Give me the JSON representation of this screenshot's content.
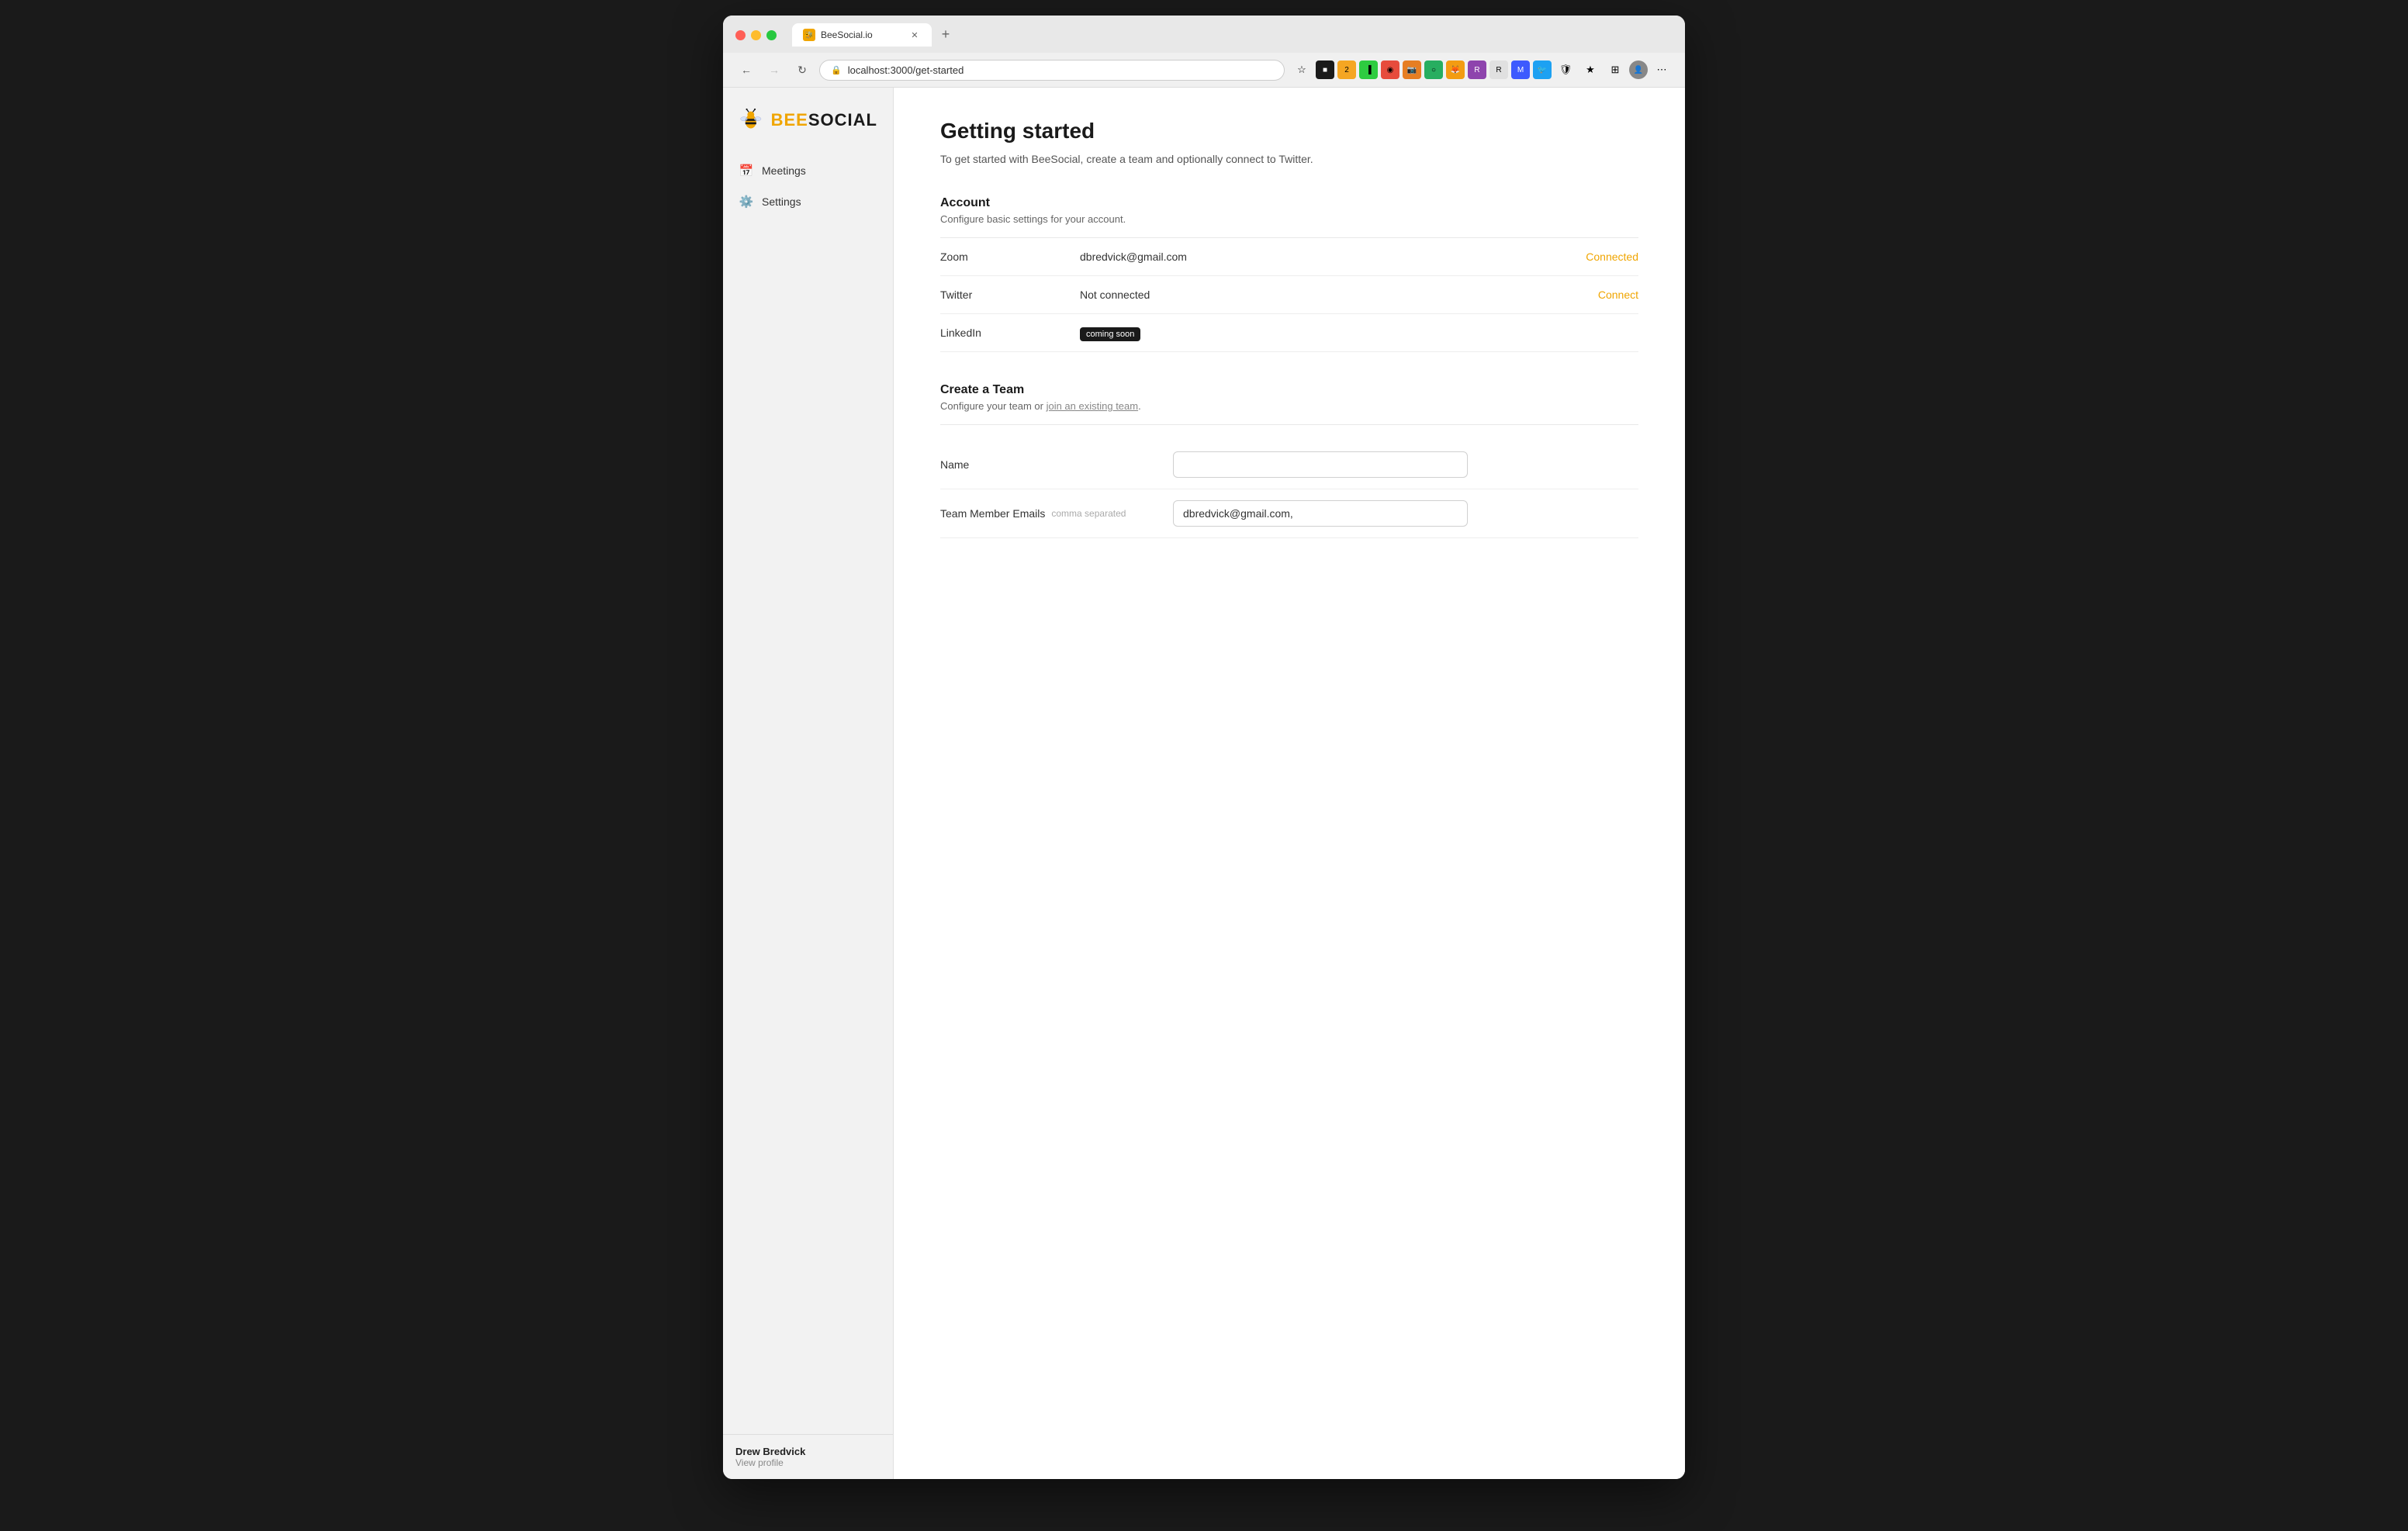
{
  "browser": {
    "url": "localhost:3000/get-started",
    "tab_title": "BeeSocial.io",
    "tab_favicon": "🐝",
    "back_disabled": false,
    "forward_disabled": true
  },
  "sidebar": {
    "logo_bee": "🐝",
    "logo_text_prefix": "BEE",
    "logo_text_suffix": "SOCIAL",
    "items": [
      {
        "id": "meetings",
        "label": "Meetings",
        "icon": "📅"
      },
      {
        "id": "settings",
        "label": "Settings",
        "icon": "⚙️"
      }
    ],
    "user": {
      "name": "Drew Bredvick",
      "view_profile_label": "View profile"
    }
  },
  "page": {
    "title": "Getting started",
    "subtitle": "To get started with BeeSocial, create a team and optionally connect to Twitter."
  },
  "account_section": {
    "title": "Account",
    "description": "Configure basic settings for your account.",
    "rows": [
      {
        "label": "Zoom",
        "value": "dbredvick@gmail.com",
        "action": "Connected",
        "action_color": "#f0a500"
      },
      {
        "label": "Twitter",
        "value": "Not connected",
        "action": "Connect",
        "action_color": "#f0a500"
      },
      {
        "label": "LinkedIn",
        "value": "",
        "badge": "coming soon",
        "action": ""
      }
    ]
  },
  "team_section": {
    "title": "Create a Team",
    "description_prefix": "Configure your team or ",
    "description_link": "join an existing team",
    "description_suffix": ".",
    "fields": [
      {
        "label": "Name",
        "placeholder": "",
        "value": "",
        "sublabel": ""
      },
      {
        "label": "Team Member Emails",
        "placeholder": "",
        "value": "dbredvick@gmail.com,",
        "sublabel": "comma separated"
      }
    ]
  }
}
